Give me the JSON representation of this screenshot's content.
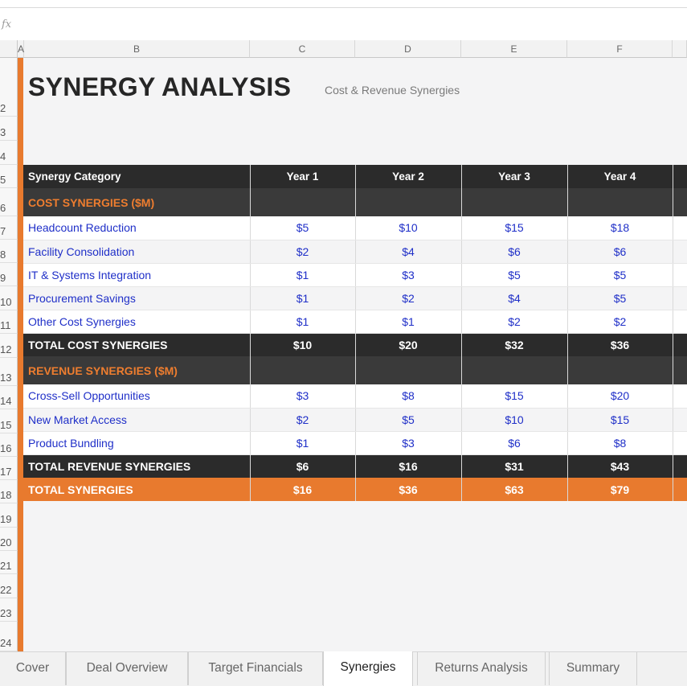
{
  "formula_bar": {
    "fx_label": "fx",
    "value": ""
  },
  "columns": [
    "A",
    "B",
    "C",
    "D",
    "E",
    "F",
    ""
  ],
  "rows": [
    "2",
    "3",
    "4",
    "5",
    "6",
    "7",
    "8",
    "9",
    "10",
    "11",
    "12",
    "13",
    "14",
    "15",
    "16",
    "17",
    "18",
    "19",
    "20",
    "21",
    "22",
    "23",
    "24"
  ],
  "title": "SYNERGY ANALYSIS",
  "subtitle": "Cost & Revenue Synergies",
  "table": {
    "header": [
      "Synergy Category",
      "Year 1",
      "Year 2",
      "Year 3",
      "Year 4"
    ],
    "cost_section": "COST SYNERGIES ($M)",
    "cost_rows": [
      {
        "label": "Headcount Reduction",
        "values": [
          "$5",
          "$10",
          "$15",
          "$18"
        ]
      },
      {
        "label": "Facility Consolidation",
        "values": [
          "$2",
          "$4",
          "$6",
          "$6"
        ]
      },
      {
        "label": "IT & Systems Integration",
        "values": [
          "$1",
          "$3",
          "$5",
          "$5"
        ]
      },
      {
        "label": "Procurement Savings",
        "values": [
          "$1",
          "$2",
          "$4",
          "$5"
        ]
      },
      {
        "label": "Other Cost Synergies",
        "values": [
          "$1",
          "$1",
          "$2",
          "$2"
        ]
      }
    ],
    "total_cost": {
      "label": "TOTAL COST SYNERGIES",
      "values": [
        "$10",
        "$20",
        "$32",
        "$36"
      ]
    },
    "revenue_section": "REVENUE SYNERGIES ($M)",
    "revenue_rows": [
      {
        "label": "Cross-Sell Opportunities",
        "values": [
          "$3",
          "$8",
          "$15",
          "$20"
        ]
      },
      {
        "label": "New Market Access",
        "values": [
          "$2",
          "$5",
          "$10",
          "$15"
        ]
      },
      {
        "label": "Product Bundling",
        "values": [
          "$1",
          "$3",
          "$6",
          "$8"
        ]
      }
    ],
    "total_revenue": {
      "label": "TOTAL REVENUE SYNERGIES",
      "values": [
        "$6",
        "$16",
        "$31",
        "$43"
      ]
    },
    "total_synergies": {
      "label": "TOTAL SYNERGIES",
      "values": [
        "$16",
        "$36",
        "$63",
        "$79"
      ]
    }
  },
  "sheet_tabs": [
    "Cover",
    "Deal Overview",
    "Target Financials",
    "Synergies",
    "Returns Analysis",
    "Summary"
  ],
  "active_tab": "Synergies",
  "colors": {
    "accent": "#e87a2e",
    "dark": "#2b2b2b",
    "link_blue": "#1f2fc8"
  }
}
